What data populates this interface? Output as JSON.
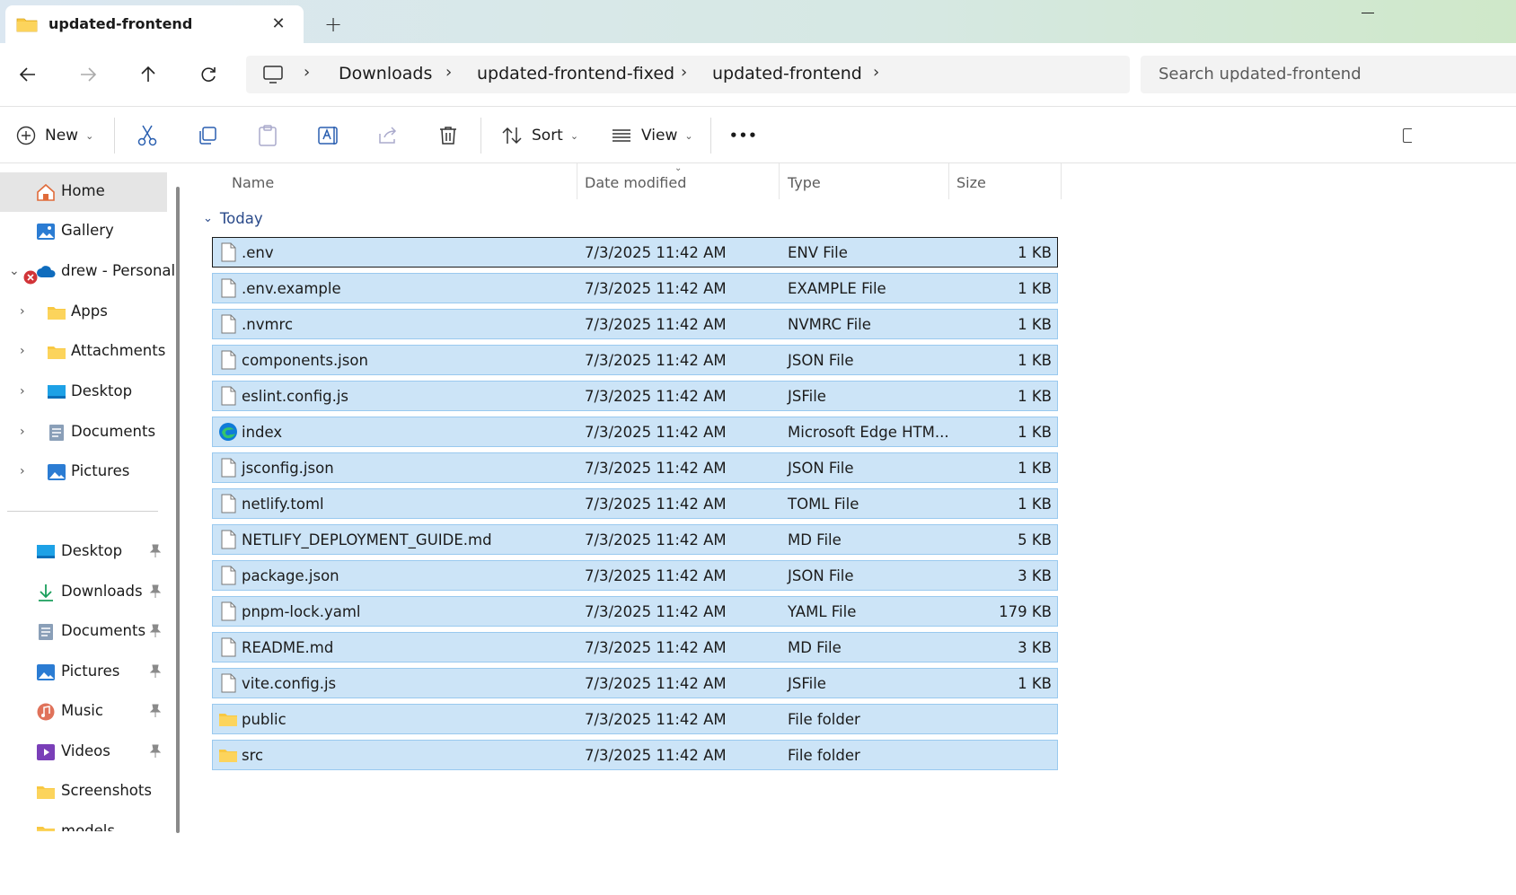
{
  "window": {
    "tab_title": "updated-frontend",
    "tab_close": "✕",
    "new_tab": "+"
  },
  "address": {
    "breadcrumbs": [
      "Downloads",
      "updated-frontend-fixed",
      "updated-frontend"
    ],
    "search_placeholder": "Search updated-frontend"
  },
  "toolbar": {
    "new_label": "New",
    "sort_label": "Sort",
    "view_label": "View",
    "more_label": "•••"
  },
  "sidebar": {
    "top": [
      {
        "label": "Home",
        "icon": "home-icon",
        "selected": true
      },
      {
        "label": "Gallery",
        "icon": "gallery-icon"
      },
      {
        "label": "drew - Personal",
        "icon": "onedrive-icon",
        "status": "error"
      }
    ],
    "onedrive_children": [
      {
        "label": "Apps",
        "icon": "folder-icon"
      },
      {
        "label": "Attachments",
        "icon": "folder-icon"
      },
      {
        "label": "Desktop",
        "icon": "desktop-icon"
      },
      {
        "label": "Documents",
        "icon": "documents-icon"
      },
      {
        "label": "Pictures",
        "icon": "pictures-icon"
      }
    ],
    "quick_access": [
      {
        "label": "Desktop",
        "icon": "desktop-icon",
        "pinned": true
      },
      {
        "label": "Downloads",
        "icon": "downloads-icon",
        "pinned": true
      },
      {
        "label": "Documents",
        "icon": "documents-icon",
        "pinned": true
      },
      {
        "label": "Pictures",
        "icon": "pictures-icon",
        "pinned": true
      },
      {
        "label": "Music",
        "icon": "music-icon",
        "pinned": true
      },
      {
        "label": "Videos",
        "icon": "videos-icon",
        "pinned": true
      },
      {
        "label": "Screenshots",
        "icon": "folder-icon",
        "pinned": false
      },
      {
        "label": "models",
        "icon": "folder-icon",
        "pinned": false
      }
    ]
  },
  "columns": {
    "name": "Name",
    "date": "Date modified",
    "type": "Type",
    "size": "Size"
  },
  "group_label": "Today",
  "files": [
    {
      "name": ".env",
      "date": "7/3/2025 11:42 AM",
      "type": "ENV File",
      "size": "1 KB",
      "icon": "file-icon"
    },
    {
      "name": ".env.example",
      "date": "7/3/2025 11:42 AM",
      "type": "EXAMPLE File",
      "size": "1 KB",
      "icon": "file-icon"
    },
    {
      "name": ".nvmrc",
      "date": "7/3/2025 11:42 AM",
      "type": "NVMRC File",
      "size": "1 KB",
      "icon": "file-icon"
    },
    {
      "name": "components.json",
      "date": "7/3/2025 11:42 AM",
      "type": "JSON File",
      "size": "1 KB",
      "icon": "file-icon"
    },
    {
      "name": "eslint.config.js",
      "date": "7/3/2025 11:42 AM",
      "type": "JSFile",
      "size": "1 KB",
      "icon": "file-icon"
    },
    {
      "name": "index",
      "date": "7/3/2025 11:42 AM",
      "type": "Microsoft Edge HTM...",
      "size": "1 KB",
      "icon": "edge-icon"
    },
    {
      "name": "jsconfig.json",
      "date": "7/3/2025 11:42 AM",
      "type": "JSON File",
      "size": "1 KB",
      "icon": "file-icon"
    },
    {
      "name": "netlify.toml",
      "date": "7/3/2025 11:42 AM",
      "type": "TOML File",
      "size": "1 KB",
      "icon": "file-icon"
    },
    {
      "name": "NETLIFY_DEPLOYMENT_GUIDE.md",
      "date": "7/3/2025 11:42 AM",
      "type": "MD File",
      "size": "5 KB",
      "icon": "file-icon"
    },
    {
      "name": "package.json",
      "date": "7/3/2025 11:42 AM",
      "type": "JSON File",
      "size": "3 KB",
      "icon": "file-icon"
    },
    {
      "name": "pnpm-lock.yaml",
      "date": "7/3/2025 11:42 AM",
      "type": "YAML File",
      "size": "179 KB",
      "icon": "file-icon"
    },
    {
      "name": "README.md",
      "date": "7/3/2025 11:42 AM",
      "type": "MD File",
      "size": "3 KB",
      "icon": "file-icon"
    },
    {
      "name": "vite.config.js",
      "date": "7/3/2025 11:42 AM",
      "type": "JSFile",
      "size": "1 KB",
      "icon": "file-icon"
    },
    {
      "name": "public",
      "date": "7/3/2025 11:42 AM",
      "type": "File folder",
      "size": "",
      "icon": "folder-icon"
    },
    {
      "name": "src",
      "date": "7/3/2025 11:42 AM",
      "type": "File folder",
      "size": "",
      "icon": "folder-icon"
    }
  ],
  "colors": {
    "selection_bg": "#cce4f7",
    "selection_border": "#99c9ef",
    "folder": "#f8c842",
    "group_text": "#2a4a8a"
  }
}
